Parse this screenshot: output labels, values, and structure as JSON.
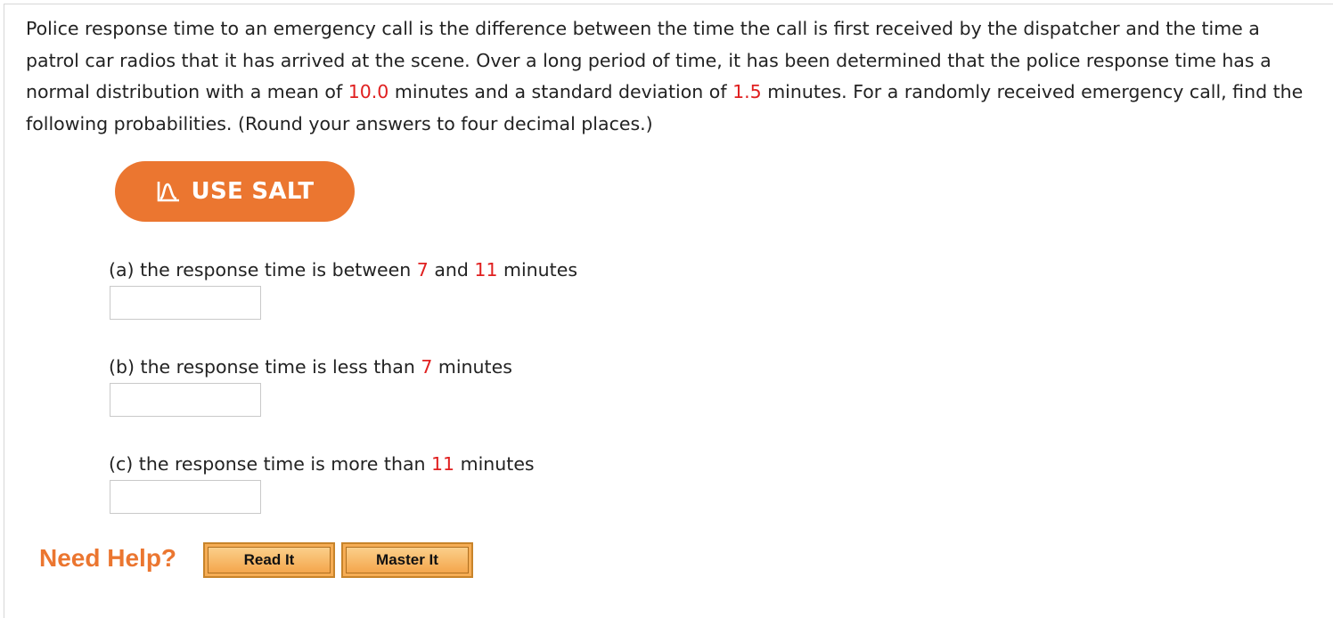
{
  "question": {
    "t1": "Police response time to an emergency call is the difference between the time the call is first received by the dispatcher and the time a patrol car radios that it has arrived at the scene. Over a long period of time, it has been determined that the police response time has a normal distribution with a mean of ",
    "mean": "10.0",
    "t2": " minutes and a standard deviation of ",
    "sd": "1.5",
    "t3": " minutes. For a randomly received emergency call, find the following probabilities. (Round your answers to four decimal places.)"
  },
  "salt_button": {
    "label": "USE SALT",
    "icon": "salt-chart-icon"
  },
  "parts": {
    "a": {
      "t1": "(a) the response time is between ",
      "v1": "7",
      "t2": " and ",
      "v2": "11",
      "t3": " minutes",
      "value": ""
    },
    "b": {
      "t1": "(b) the response time is less than ",
      "v1": "7",
      "t2": " minutes",
      "value": ""
    },
    "c": {
      "t1": "(c) the response time is more than ",
      "v1": "11",
      "t2": " minutes",
      "value": ""
    }
  },
  "help": {
    "label": "Need Help?",
    "read_it": "Read It",
    "master_it": "Master It"
  },
  "colors": {
    "accent": "#eb7630",
    "highlight_number": "#e02020",
    "button_fill": "#f6ad55"
  }
}
